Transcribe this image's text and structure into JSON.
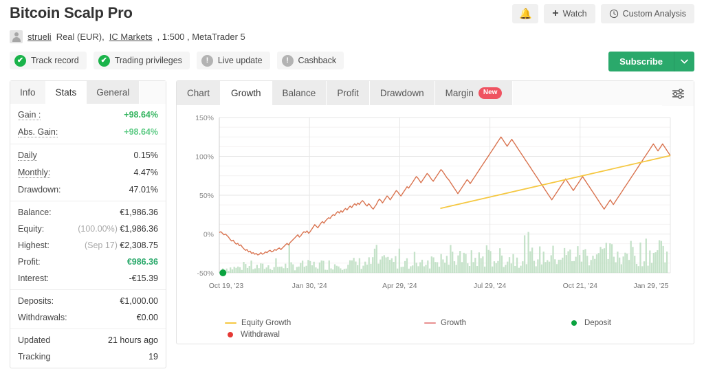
{
  "header": {
    "title": "Bitcoin Scalp Pro",
    "bell_icon": "bell-icon",
    "watch_label": "Watch",
    "watch_icon": "plus-icon",
    "custom_analysis_label": "Custom Analysis",
    "custom_analysis_icon": "clock-icon",
    "subscribe_label": "Subscribe",
    "subscribe_caret": "▼",
    "subscribe_color": "#2aa96b"
  },
  "account": {
    "avatar": "user-avatar-icon",
    "username": "strueli",
    "type_text": "Real (EUR),",
    "broker": "IC Markets",
    "leverage_text": ", 1:500 , MetaTrader 5"
  },
  "badges": [
    {
      "label": "Track record",
      "state": "ok",
      "glyph": "✔"
    },
    {
      "label": "Trading privileges",
      "state": "ok",
      "glyph": "✔"
    },
    {
      "label": "Live update",
      "state": "warn",
      "glyph": "!"
    },
    {
      "label": "Cashback",
      "state": "warn",
      "glyph": "!"
    }
  ],
  "sidebar": {
    "tabs": [
      {
        "label": "Info",
        "active": false
      },
      {
        "label": "Stats",
        "active": true
      },
      {
        "label": "General",
        "active": false
      }
    ],
    "groups": [
      {
        "rows": [
          {
            "label": "Gain :",
            "value": "+98.64%",
            "style": "green",
            "underline": "dotted"
          },
          {
            "label": "Abs. Gain:",
            "value": "+98.64%",
            "style": "green-lt",
            "underline": "dotted"
          }
        ]
      },
      {
        "rows": [
          {
            "label": "Daily",
            "value": "0.15%",
            "style": "",
            "underline": "dotted"
          },
          {
            "label": "Monthly:",
            "value": "4.47%",
            "style": "",
            "underline": "dotted"
          },
          {
            "label": "Drawdown:",
            "value": "47.01%",
            "style": "",
            "underline": "none"
          }
        ]
      },
      {
        "rows": [
          {
            "label": "Balance:",
            "value": "€1,986.36",
            "style": "",
            "underline": "none"
          },
          {
            "label": "Equity:",
            "value": "€1,986.36",
            "prefix": "(100.00%)",
            "style": "",
            "underline": "none"
          },
          {
            "label": "Highest:",
            "value": "€2,308.75",
            "prefix": "(Sep 17)",
            "style": "",
            "underline": "none"
          },
          {
            "label": "Profit:",
            "value": "€986.36",
            "style": "profit",
            "underline": "none"
          },
          {
            "label": "Interest:",
            "value": "-€15.39",
            "style": "",
            "underline": "none"
          }
        ]
      },
      {
        "rows": [
          {
            "label": "Deposits:",
            "value": "€1,000.00",
            "style": "",
            "underline": "none"
          },
          {
            "label": "Withdrawals:",
            "value": "€0.00",
            "style": "",
            "underline": "none"
          }
        ]
      },
      {
        "rows": [
          {
            "label": "Updated",
            "value": "21 hours ago",
            "style": "",
            "underline": "none"
          },
          {
            "label": "Tracking",
            "value": "19",
            "style": "",
            "underline": "none"
          }
        ]
      }
    ]
  },
  "chart_panel": {
    "tabs": [
      {
        "label": "Chart",
        "active": false,
        "badge": ""
      },
      {
        "label": "Growth",
        "active": true,
        "badge": ""
      },
      {
        "label": "Balance",
        "active": false,
        "badge": ""
      },
      {
        "label": "Profit",
        "active": false,
        "badge": ""
      },
      {
        "label": "Drawdown",
        "active": false,
        "badge": ""
      },
      {
        "label": "Margin",
        "active": false,
        "badge": "New"
      }
    ],
    "settings_icon": "sliders-icon"
  },
  "chart_data": {
    "type": "line",
    "title": "Growth",
    "xlabel": "",
    "ylabel": "",
    "ylim": [
      -50,
      150
    ],
    "yticks": [
      150,
      100,
      50,
      0,
      -50
    ],
    "ytick_labels": [
      "150%",
      "100%",
      "50%",
      "0%",
      "-50%"
    ],
    "xtick_labels": [
      "Oct 19, '23",
      "Jan 30, '24",
      "Apr 29, '24",
      "Jul 29, '24",
      "Oct 21, '24",
      "Jan 29, '25"
    ],
    "grid": true,
    "legend_position": "bottom",
    "legend": [
      {
        "name": "Equity Growth",
        "color": "#f5c842",
        "marker": "line"
      },
      {
        "name": "Growth",
        "color": "#e06c6c",
        "marker": "line"
      },
      {
        "name": "Deposit",
        "color": "#0aa33f",
        "marker": "dot"
      },
      {
        "name": "Withdrawal",
        "color": "#e53935",
        "marker": "dot"
      }
    ],
    "series": [
      {
        "name": "Growth",
        "color": "#d9734f",
        "type": "line",
        "values": [
          2,
          3,
          1,
          -1,
          0,
          -2,
          -4,
          -7,
          -9,
          -8,
          -11,
          -13,
          -12,
          -15,
          -14,
          -17,
          -19,
          -21,
          -20,
          -23,
          -22,
          -25,
          -24,
          -26,
          -25,
          -27,
          -26,
          -24,
          -26,
          -25,
          -23,
          -24,
          -22,
          -21,
          -23,
          -22,
          -20,
          -21,
          -19,
          -18,
          -20,
          -18,
          -16,
          -14,
          -12,
          -14,
          -11,
          -9,
          -7,
          -5,
          -3,
          -1,
          -4,
          -2,
          1,
          3,
          2,
          4,
          1,
          3,
          6,
          9,
          12,
          10,
          8,
          11,
          14,
          16,
          14,
          17,
          19,
          21,
          20,
          23,
          25,
          24,
          27,
          29,
          27,
          30,
          28,
          31,
          33,
          31,
          34,
          36,
          34,
          37,
          39,
          37,
          40,
          38,
          41,
          43,
          41,
          38,
          36,
          39,
          37,
          34,
          32,
          35,
          38,
          42,
          45,
          43,
          40,
          43,
          46,
          49,
          47,
          44,
          47,
          50,
          53,
          56,
          54,
          51,
          49,
          52,
          55,
          58,
          61,
          59,
          62,
          65,
          68,
          71,
          74,
          72,
          69,
          66,
          69,
          72,
          75,
          78,
          76,
          73,
          70,
          68,
          71,
          74,
          77,
          80,
          83,
          81,
          78,
          75,
          72,
          70,
          67,
          64,
          61,
          58,
          55,
          52,
          55,
          58,
          61,
          64,
          67,
          70,
          68,
          65,
          68,
          71,
          74,
          77,
          80,
          83,
          86,
          89,
          92,
          95,
          98,
          101,
          104,
          107,
          110,
          113,
          116,
          119,
          122,
          125,
          122,
          119,
          116,
          113,
          116,
          119,
          122,
          119,
          116,
          113,
          110,
          107,
          104,
          101,
          98,
          95,
          92,
          89,
          86,
          83,
          80,
          77,
          74,
          71,
          68,
          65,
          62,
          59,
          56,
          53,
          50,
          47,
          44,
          47,
          50,
          53,
          56,
          59,
          62,
          65,
          68,
          71,
          68,
          65,
          62,
          59,
          56,
          59,
          62,
          65,
          68,
          71,
          74,
          71,
          68,
          65,
          62,
          59,
          56,
          53,
          50,
          47,
          44,
          41,
          38,
          35,
          32,
          35,
          38,
          41,
          44,
          41,
          38,
          41,
          44,
          47,
          50,
          53,
          56,
          59,
          62,
          65,
          68,
          71,
          74,
          77,
          80,
          83,
          86,
          89,
          92,
          95,
          98,
          101,
          104,
          107,
          110,
          113,
          116,
          113,
          110,
          107,
          110,
          113,
          116,
          113,
          110,
          107,
          104,
          101
        ]
      },
      {
        "name": "Equity Growth",
        "color": "#f5c842",
        "type": "trendline",
        "start": {
          "x_pct": 49,
          "y": 33
        },
        "end": {
          "x_pct": 100,
          "y": 101
        }
      }
    ],
    "bars": {
      "name": "Deposit Bars",
      "color": "#bfdfc3",
      "note": "light green vertical bars rising from the -50% baseline, increasing in density and height toward the right"
    },
    "markers": [
      {
        "name": "Deposit",
        "x_pct": 0.8,
        "y": -50,
        "color": "#0aa33f"
      }
    ]
  }
}
